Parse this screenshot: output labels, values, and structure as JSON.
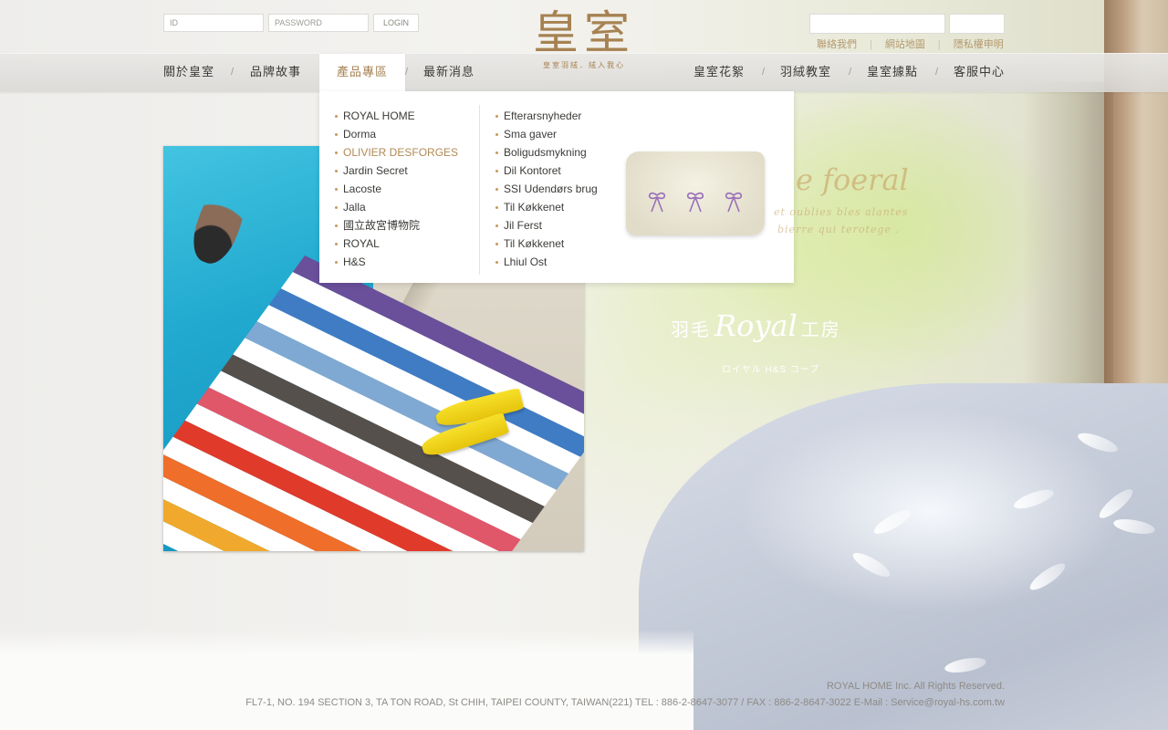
{
  "header": {
    "id_placeholder": "ID",
    "password_placeholder": "PASSWORD",
    "login_label": "LOGIN",
    "logo_main": "皇室",
    "logo_sub": "皇室羽絨．絨入我心",
    "utility_links": [
      "聯絡我們",
      "網站地圖",
      "隱私權申明"
    ]
  },
  "nav": {
    "left": [
      "關於皇室",
      "品牌故事",
      "產品專區",
      "最新消息"
    ],
    "right": [
      "皇室花絮",
      "羽絨教室",
      "皇室據點",
      "客服中心"
    ],
    "active": "產品專區",
    "separator": "/"
  },
  "dropdown": {
    "col1": [
      "ROYAL HOME",
      "Dorma",
      "OLIVIER DESFORGES",
      "Jardin Secret",
      "Lacoste",
      "Jalla",
      "國立故宮博物院",
      "ROYAL",
      "H&S"
    ],
    "col2": [
      "Efterarsnyheder",
      "Sma gaver",
      "Boligudsmykning",
      "Dil Kontoret",
      "SSI Udendørs brug",
      "Til Køkkenet",
      "Jil Ferst",
      "Til Køkkenet",
      "Lhiul Ost"
    ],
    "active_item": "OLIVIER DESFORGES"
  },
  "decor": {
    "script_title": "e foeral",
    "script_line1": "et oublies bles alantes",
    "script_line2": "bierre qui terotege .",
    "royal_cjk_left": "羽毛",
    "royal_script": "Royal",
    "royal_cjk_right": "工房",
    "royal_small": "ロイヤル H&S コープ"
  },
  "footer": {
    "copyright": "ROYAL HOME Inc. All Rights Reserved.",
    "address": "FL7-1, NO. 194 SECTION 3, TA TON ROAD, St CHIH, TAIPEI COUNTY, TAIWAN(221)  TEL : 886-2-8647-3077 / FAX : 886-2-8647-3022  E-Mail : Service@royal-hs.com.tw"
  },
  "colors": {
    "accent": "#a68252",
    "nav_text": "#3b3a37",
    "bullet": "#c59a5e"
  }
}
